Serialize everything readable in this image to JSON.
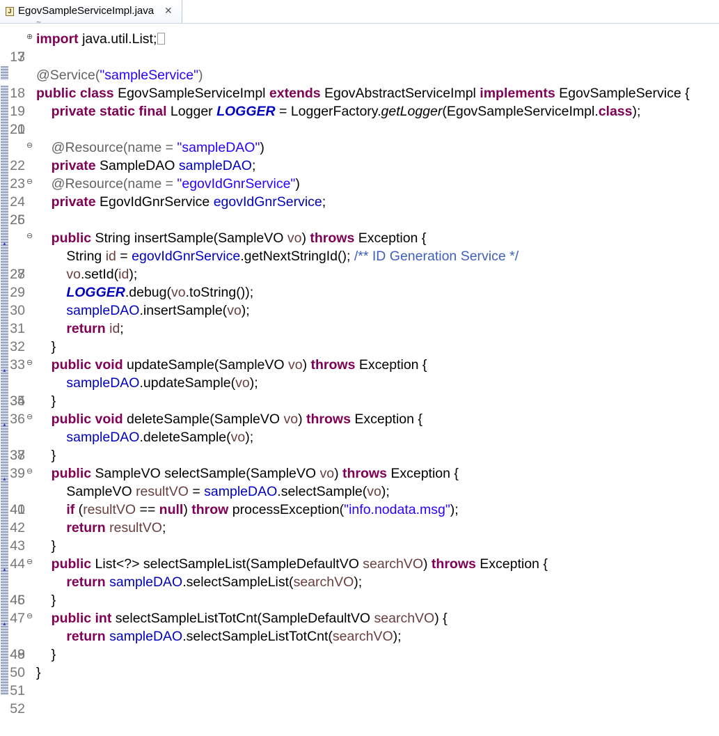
{
  "tab": {
    "title": "EgovSampleServiceImpl.java",
    "close": "✕"
  },
  "line_numbers": [
    "3",
    "17",
    "18",
    "19",
    "20",
    "21",
    "22",
    "23",
    "24",
    "25",
    "26",
    "27",
    "28",
    "29",
    "30",
    "31",
    "32",
    "33",
    "34",
    "35",
    "36",
    "37",
    "38",
    "39",
    "40",
    "41",
    "42",
    "43",
    "44",
    "45",
    "46",
    "47",
    "48",
    "49",
    "50",
    "51",
    "52"
  ],
  "code": {
    "l3": [
      "import",
      " java.util.List;"
    ],
    "l18": [
      "@Service(",
      "\"sampleService\"",
      ")"
    ],
    "l19": [
      "public",
      " ",
      "class",
      " EgovSampleServiceImpl ",
      "extends",
      " EgovAbstractServiceImpl ",
      "implements",
      " EgovSampleService {"
    ],
    "l20": [
      "    ",
      "private",
      " ",
      "static",
      " ",
      "final",
      " Logger ",
      "LOGGER",
      " = LoggerFactory.",
      "getLogger",
      "(EgovSampleServiceImpl.",
      "class",
      ");"
    ],
    "l22": [
      "    ",
      "@Resource(name = ",
      "\"sampleDAO\"",
      ")"
    ],
    "l23": [
      "    ",
      "private",
      " SampleDAO ",
      "sampleDAO",
      ";"
    ],
    "l24": [
      "    ",
      "@Resource(name = ",
      "\"egovIdGnrService\"",
      ")"
    ],
    "l25": [
      "    ",
      "private",
      " EgovIdGnrService ",
      "egovIdGnrService",
      ";"
    ],
    "l27": [
      "    ",
      "public",
      " String insertSample(SampleVO ",
      "vo",
      ") ",
      "throws",
      " Exception {"
    ],
    "l28": [
      "        String ",
      "id",
      " = ",
      "egovIdGnrService",
      ".getNextStringId(); ",
      "/** ID Generation Service */"
    ],
    "l29": [
      "        ",
      "vo",
      ".setId(",
      "id",
      ");"
    ],
    "l30": [
      "        ",
      "LOGGER",
      ".debug(",
      "vo",
      ".toString());"
    ],
    "l31": [
      "        ",
      "sampleDAO",
      ".insertSample(",
      "vo",
      ");"
    ],
    "l32": [
      "        ",
      "return",
      " ",
      "id",
      ";"
    ],
    "l33": [
      "    }"
    ],
    "l34": [
      "    ",
      "public",
      " ",
      "void",
      " updateSample(SampleVO ",
      "vo",
      ") ",
      "throws",
      " Exception {"
    ],
    "l35": [
      "        ",
      "sampleDAO",
      ".updateSample(",
      "vo",
      ");"
    ],
    "l36": [
      "    }"
    ],
    "l37": [
      "    ",
      "public",
      " ",
      "void",
      " deleteSample(SampleVO ",
      "vo",
      ") ",
      "throws",
      " Exception {"
    ],
    "l38": [
      "        ",
      "sampleDAO",
      ".deleteSample(",
      "vo",
      ");"
    ],
    "l39": [
      "    }"
    ],
    "l40": [
      "    ",
      "public",
      " SampleVO selectSample(SampleVO ",
      "vo",
      ") ",
      "throws",
      " Exception {"
    ],
    "l41": [
      "        SampleVO ",
      "resultVO",
      " = ",
      "sampleDAO",
      ".selectSample(",
      "vo",
      ");"
    ],
    "l42": [
      "        ",
      "if",
      " (",
      "resultVO",
      " == ",
      "null",
      ") ",
      "throw",
      " processException(",
      "\"info.nodata.msg\"",
      ");"
    ],
    "l43": [
      "        ",
      "return",
      " ",
      "resultVO",
      ";"
    ],
    "l44": [
      "    }"
    ],
    "l45": [
      "    ",
      "public",
      " List<?> selectSampleList(SampleDefaultVO ",
      "searchVO",
      ") ",
      "throws",
      " Exception {"
    ],
    "l46": [
      "        ",
      "return",
      " ",
      "sampleDAO",
      ".selectSampleList(",
      "searchVO",
      ");"
    ],
    "l47": [
      "    }"
    ],
    "l48": [
      "    ",
      "public",
      " ",
      "int",
      " selectSampleListTotCnt(SampleDefaultVO ",
      "searchVO",
      ") {"
    ],
    "l49": [
      "        ",
      "return",
      " ",
      "sampleDAO",
      ".selectSampleListTotCnt(",
      "searchVO",
      ");"
    ],
    "l50": [
      "    }"
    ],
    "l51": [
      "}"
    ]
  },
  "colors": {
    "keyword": "#7f0055",
    "string": "#2a00ff",
    "field": "#0000c0",
    "annotation": "#646464",
    "comment": "#3f5fbf"
  }
}
